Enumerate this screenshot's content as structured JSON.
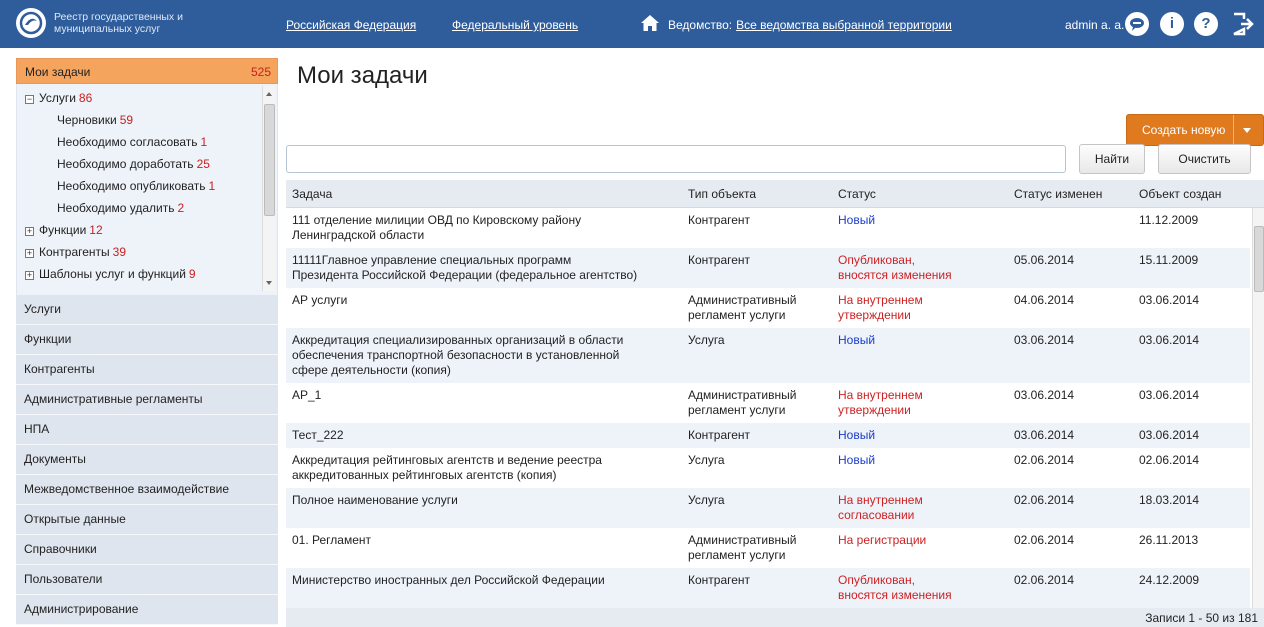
{
  "header": {
    "logo_text": "Реестр государственных и муниципальных услуг",
    "links": [
      "Российская Федерация",
      "Федеральный уровень"
    ],
    "dept_label": "Ведомство:",
    "dept_value": "Все ведомства выбранной территории",
    "user": "admin a. a.",
    "icons": [
      "chat-icon",
      "info-icon",
      "help-icon",
      "logout-icon"
    ]
  },
  "sidebar": {
    "my_tasks": {
      "label": "Мои задачи",
      "count": "525"
    },
    "tree": [
      {
        "label": "Услуги",
        "count": "86",
        "toggle": "⊟"
      },
      {
        "label": "Черновики",
        "count": "59"
      },
      {
        "label": "Необходимо согласовать",
        "count": "1"
      },
      {
        "label": "Необходимо доработать",
        "count": "25"
      },
      {
        "label": "Необходимо опубликовать",
        "count": "1"
      },
      {
        "label": "Необходимо удалить",
        "count": "2"
      },
      {
        "label": "Функции",
        "count": "12",
        "toggle": "⊞"
      },
      {
        "label": "Контрагенты",
        "count": "39",
        "toggle": "⊞"
      },
      {
        "label": "Шаблоны услуг и функций",
        "count": "9",
        "toggle": "⊞"
      }
    ],
    "menu": [
      "Услуги",
      "Функции",
      "Контрагенты",
      "Административные регламенты",
      "НПА",
      "Документы",
      "Межведомственное взаимодействие",
      "Открытые данные",
      "Справочники",
      "Пользователи",
      "Администрирование"
    ]
  },
  "main": {
    "title": "Мои задачи",
    "create_button": "Создать новую услугу",
    "search": {
      "value": "",
      "placeholder": ""
    },
    "find_button": "Найти",
    "clear_button": "Очистить",
    "columns": [
      "Задача",
      "Тип объекта",
      "Статус",
      "Статус изменен",
      "Объект создан"
    ],
    "rows": [
      {
        "task": [
          "111 отделение милиции ОВД по Кировскому району",
          "Ленинградской области"
        ],
        "type": [
          "Контрагент"
        ],
        "status": [
          "Новый"
        ],
        "status_color": "#1a3dc8",
        "changed": "",
        "created": "11.12.2009"
      },
      {
        "task": [
          "11111Главное управление специальных программ",
          "Президента Российской Федерации (федеральное агентство)"
        ],
        "type": [
          "Контрагент"
        ],
        "status": [
          "Опубликован,",
          "вносятся изменения"
        ],
        "status_color": "#cc2222",
        "changed": "05.06.2014",
        "created": "15.11.2009"
      },
      {
        "task": [
          "АР услуги"
        ],
        "type": [
          "Административный",
          "регламент услуги"
        ],
        "status": [
          "На внутреннем",
          "утверждении"
        ],
        "status_color": "#cc2222",
        "changed": "04.06.2014",
        "created": "03.06.2014"
      },
      {
        "task": [
          "Аккредитация специализированных организаций в области",
          "обеспечения транспортной безопасности в установленной",
          "сфере деятельности (копия)"
        ],
        "type": [
          "Услуга"
        ],
        "status": [
          "Новый"
        ],
        "status_color": "#1a3dc8",
        "changed": "03.06.2014",
        "created": "03.06.2014"
      },
      {
        "task": [
          "АР_1"
        ],
        "type": [
          "Административный",
          "регламент услуги"
        ],
        "status": [
          "На внутреннем",
          "утверждении"
        ],
        "status_color": "#cc2222",
        "changed": "03.06.2014",
        "created": "03.06.2014"
      },
      {
        "task": [
          "Тест_222"
        ],
        "type": [
          "Контрагент"
        ],
        "status": [
          "Новый"
        ],
        "status_color": "#1a3dc8",
        "changed": "03.06.2014",
        "created": "03.06.2014"
      },
      {
        "task": [
          "Аккредитация рейтинговых агентств и ведение реестра",
          "аккредитованных рейтинговых агентств (копия)"
        ],
        "type": [
          "Услуга"
        ],
        "status": [
          "Новый"
        ],
        "status_color": "#1a3dc8",
        "changed": "02.06.2014",
        "created": "02.06.2014"
      },
      {
        "task": [
          "Полное наименование услуги"
        ],
        "type": [
          "Услуга"
        ],
        "status": [
          "На внутреннем",
          "согласовании"
        ],
        "status_color": "#cc2222",
        "changed": "02.06.2014",
        "created": "18.03.2014"
      },
      {
        "task": [
          "01. Регламент"
        ],
        "type": [
          "Административный",
          "регламент услуги"
        ],
        "status": [
          "На регистрации"
        ],
        "status_color": "#cc2222",
        "changed": "02.06.2014",
        "created": "26.11.2013"
      },
      {
        "task": [
          "Министерство иностранных дел Российской Федерации"
        ],
        "type": [
          "Контрагент"
        ],
        "status": [
          "Опубликован,",
          "вносятся изменения"
        ],
        "status_color": "#cc2222",
        "changed": "02.06.2014",
        "created": "24.12.2009"
      }
    ],
    "records": "Записи 1 - 50 из 181"
  }
}
